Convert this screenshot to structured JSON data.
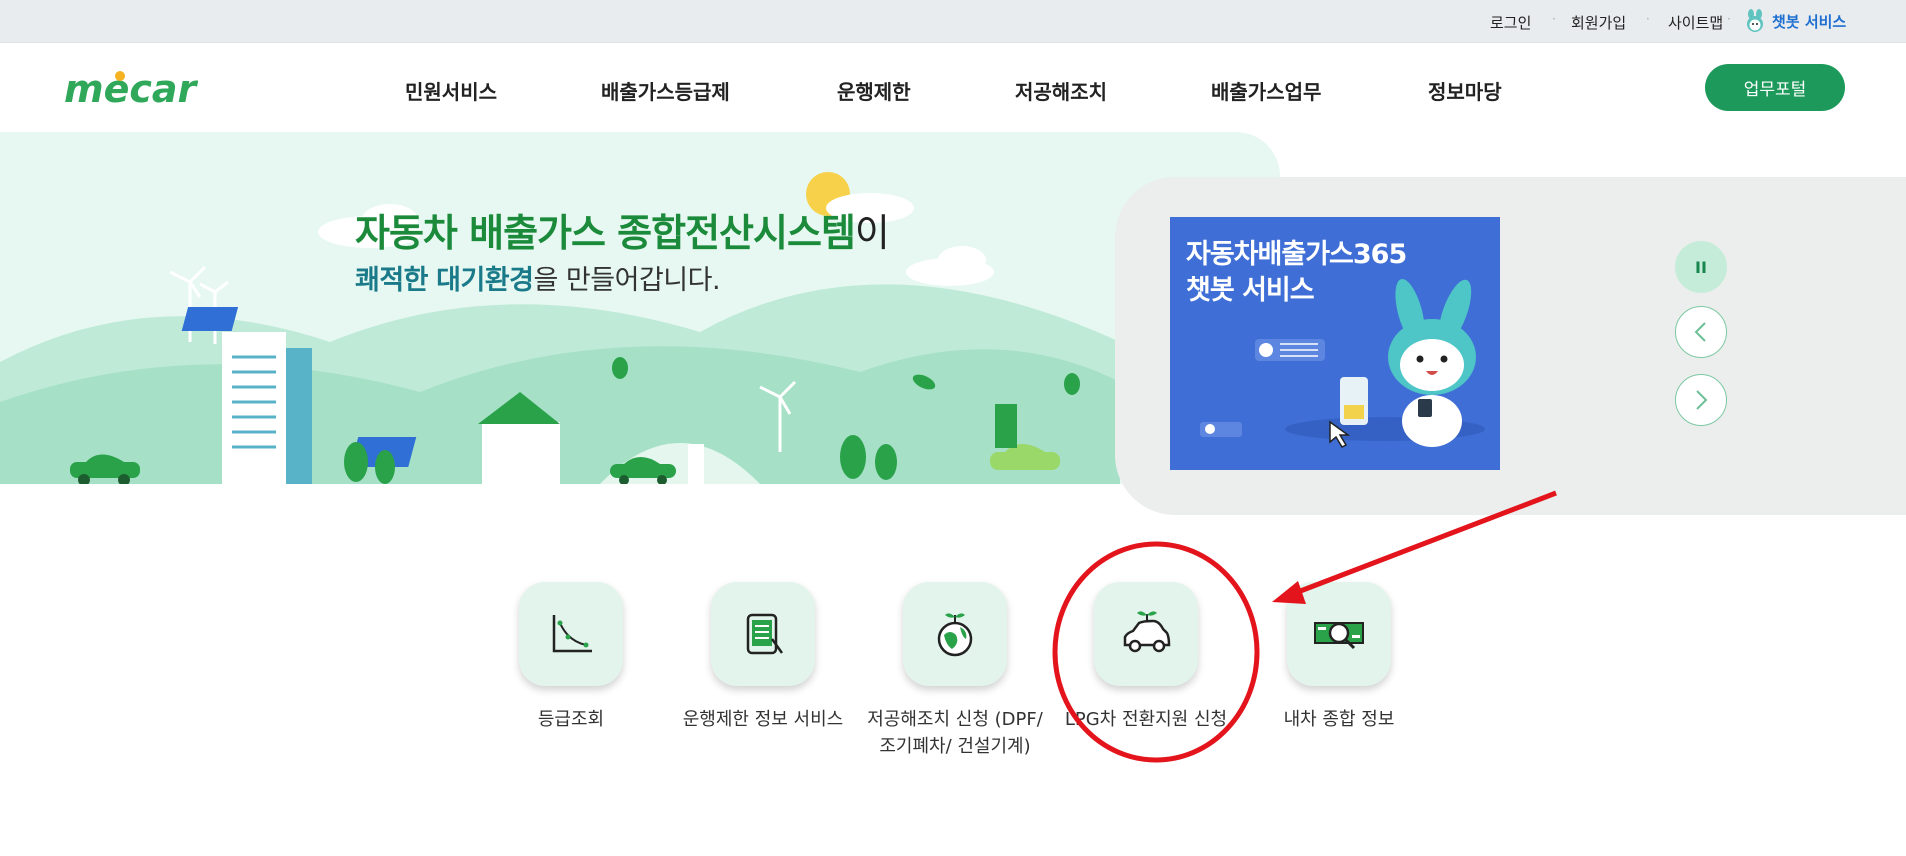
{
  "topbar": {
    "login": "로그인",
    "signup": "회원가입",
    "sitemap": "사이트맵",
    "chatbot": "챗봇 서비스"
  },
  "header": {
    "logo": "mecar",
    "nav": [
      "민원서비스",
      "배출가스등급제",
      "운행제한",
      "저공해조치",
      "배출가스업무",
      "정보마당"
    ],
    "portal_button": "업무포털"
  },
  "hero": {
    "title_main": "자동차 배출가스 종합전산시스템",
    "title_suffix": "이",
    "sub_highlight1": "쾌적한",
    "sub_highlight2": "대기환경",
    "sub_rest": "을 만들어갑니다."
  },
  "banner": {
    "line1": "자동차배출가스365",
    "line2": "챗봇 서비스",
    "pause_label": "II"
  },
  "quick_menu": [
    {
      "label": "등급조회",
      "icon": "graph-icon"
    },
    {
      "label": "운행제한 정보 서비스",
      "icon": "tablet-icon"
    },
    {
      "label": "저공해조치 신청 (DPF/조기폐차/ 건설기계)",
      "icon": "globe-sprout-icon"
    },
    {
      "label": "LPG차 전환지원 신청",
      "icon": "eco-car-icon"
    },
    {
      "label": "내차 종합 정보",
      "icon": "car-search-icon"
    }
  ],
  "colors": {
    "brand_green": "#1d9a5b",
    "title_green": "#1b8a3a",
    "banner_blue": "#3f6fd6",
    "annotation_red": "#e3141b",
    "hero_bg": "#e6f8f1"
  }
}
